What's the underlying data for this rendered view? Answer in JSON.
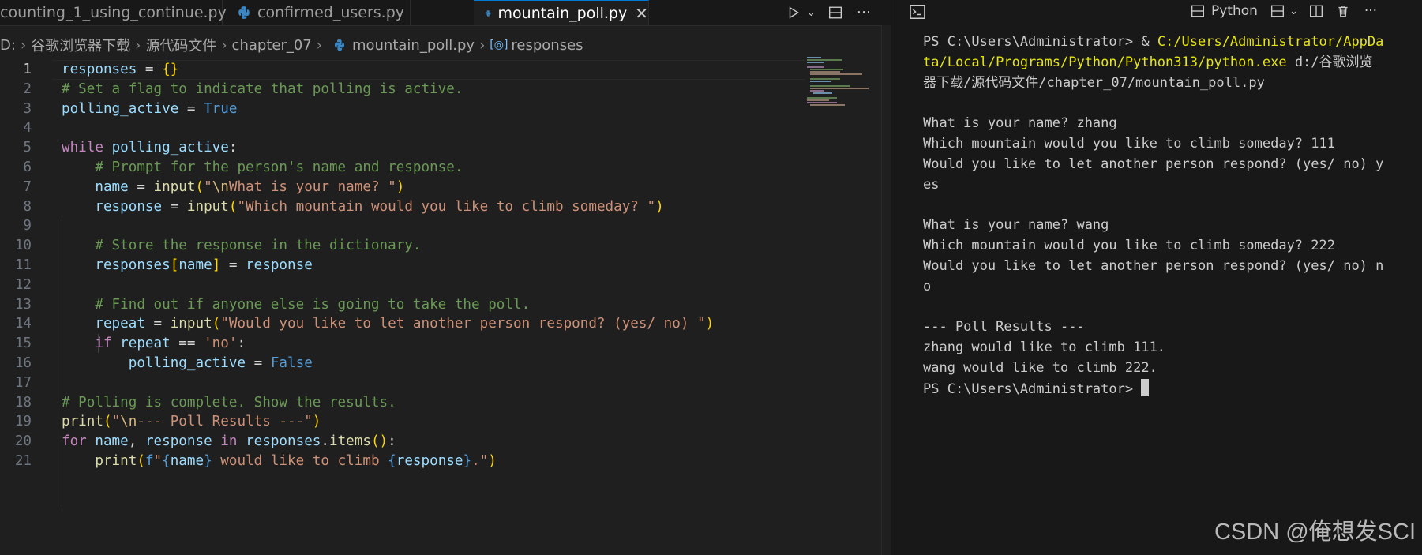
{
  "tabs": [
    {
      "label": "counting_1_using_continue.py",
      "active": false
    },
    {
      "label": "confirmed_users.py",
      "active": false
    },
    {
      "label": "mountain_poll.py",
      "active": true
    }
  ],
  "tab_icons": {
    "python": "python-file-icon",
    "close": "close-icon",
    "run": "run-play-icon",
    "split": "split-editor-icon",
    "more": "more-actions-icon"
  },
  "breadcrumb": [
    "D:",
    "谷歌浏览器下载",
    "源代码文件",
    "chapter_07",
    "mountain_poll.py",
    "responses"
  ],
  "code_lines": [
    "1",
    "2",
    "3",
    "4",
    "5",
    "6",
    "7",
    "8",
    "9",
    "10",
    "11",
    "12",
    "13",
    "14",
    "15",
    "16",
    "17",
    "18",
    "19",
    "20",
    "21"
  ],
  "code": [
    "responses = {}",
    "# Set a flag to indicate that polling is active.",
    "polling_active = True",
    "",
    "while polling_active:",
    "    # Prompt for the person's name and response.",
    "    name = input(\"\\nWhat is your name? \")",
    "    response = input(\"Which mountain would you like to climb someday? \")",
    "",
    "    # Store the response in the dictionary.",
    "    responses[name] = response",
    "",
    "    # Find out if anyone else is going to take the poll.",
    "    repeat = input(\"Would you like to let another person respond? (yes/ no) \")",
    "    if repeat == 'no':",
    "        polling_active = False",
    "",
    "# Polling is complete. Show the results.",
    "print(\"\\n--- Poll Results ---\")",
    "for name, response in responses.items():",
    "    print(f\"{name} would like to climb {response}.\")"
  ],
  "terminal": {
    "icon": "terminal-icon",
    "profile_label": "Python",
    "icons": [
      "layout-icon",
      "chevron-down-icon",
      "split-terminal-icon",
      "trash-icon",
      "more-actions-icon"
    ],
    "prompt_cmd_prefix": "PS C:\\Users\\Administrator> & ",
    "cmd_path_1": "C:/Users/Administrator/AppDa",
    "cmd_path_2": "ta/Local/Programs/Python/Python313/python.exe",
    "cmd_arg_1": " d:/谷歌浏览",
    "cmd_arg_2": "器下载/源代码文件/chapter_07/mountain_poll.py",
    "output": [
      "",
      "What is your name? zhang",
      "Which mountain would you like to climb someday? 111",
      "Would you like to let another person respond? (yes/ no) y",
      "es",
      "",
      "What is your name? wang",
      "Which mountain would you like to climb someday? 222",
      "Would you like to let another person respond? (yes/ no) n",
      "o",
      "",
      "--- Poll Results ---",
      "zhang would like to climb 111.",
      "wang would like to climb 222."
    ],
    "final_prompt": "PS C:\\Users\\Administrator> "
  },
  "watermark": "CSDN @俺想发SCI"
}
